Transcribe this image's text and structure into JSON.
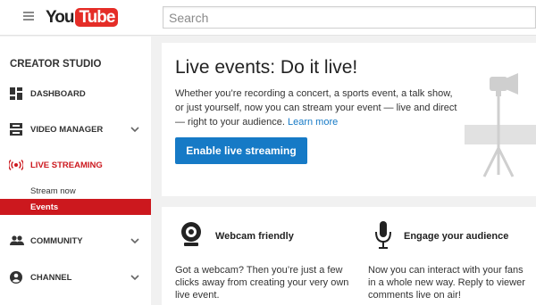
{
  "header": {
    "logo_you": "You",
    "logo_tube": "Tube",
    "search_placeholder": "Search"
  },
  "sidebar": {
    "title": "CREATOR STUDIO",
    "items": [
      {
        "label": "DASHBOARD",
        "icon": "dashboard-icon"
      },
      {
        "label": "VIDEO MANAGER",
        "icon": "video-manager-icon"
      },
      {
        "label": "LIVE STREAMING",
        "icon": "live-streaming-icon",
        "active": true
      },
      {
        "label": "COMMUNITY",
        "icon": "community-icon"
      },
      {
        "label": "CHANNEL",
        "icon": "channel-icon"
      }
    ],
    "subitems": [
      {
        "label": "Stream now"
      },
      {
        "label": "Events",
        "selected": true
      }
    ]
  },
  "hero": {
    "title": "Live events: Do it live!",
    "description": "Whether you’re recording a concert, a sports event, a talk show, or just yourself, now you can stream your event — live and direct — right to your audience.",
    "learn_more": "Learn more",
    "button_label": "Enable live streaming"
  },
  "features": [
    {
      "icon": "webcam-icon",
      "title": "Webcam friendly",
      "description": "Got a webcam? Then you’re just a few clicks away from creating your very own live event."
    },
    {
      "icon": "microphone-icon",
      "title": "Engage your audience",
      "description": "Now you can interact with your fans in a whole new way. Reply to viewer comments live on air!"
    }
  ],
  "colors": {
    "brand_red": "#cc181e",
    "link_blue": "#167ac6",
    "logo_red": "#e52d27"
  }
}
